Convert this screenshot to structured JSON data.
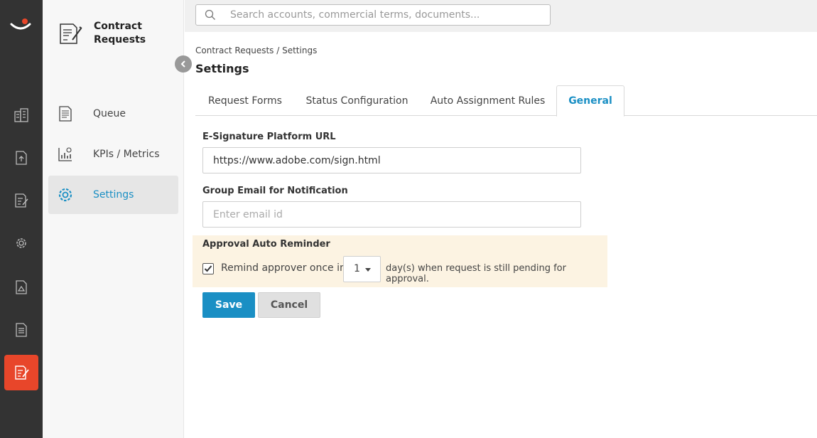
{
  "app": {
    "title": "Contract Requests"
  },
  "sidebar": {
    "items": [
      {
        "label": "Queue"
      },
      {
        "label": "KPIs / Metrics"
      },
      {
        "label": "Settings"
      }
    ]
  },
  "search": {
    "placeholder": "Search accounts, commercial terms, documents..."
  },
  "breadcrumb": "Contract Requests / Settings",
  "page_title": "Settings",
  "tabs": [
    {
      "label": "Request Forms"
    },
    {
      "label": "Status Configuration"
    },
    {
      "label": "Auto Assignment Rules"
    },
    {
      "label": "General"
    }
  ],
  "form": {
    "esign_label": "E-Signature Platform URL",
    "esign_value": "https://www.adobe.com/sign.html",
    "email_label": "Group Email for Notification",
    "email_placeholder": "Enter email id",
    "reminder_title": "Approval Auto Reminder",
    "reminder_text_before": "Remind approver once in",
    "reminder_days": "1",
    "reminder_text_after": "day(s) when request is still pending for approval.",
    "reminder_checked": true
  },
  "buttons": {
    "save": "Save",
    "cancel": "Cancel"
  },
  "colors": {
    "accent": "#1a8fc4",
    "rail_bg": "#333333",
    "rail_active": "#e8462a",
    "reminder_bg": "#fcf3e2"
  }
}
